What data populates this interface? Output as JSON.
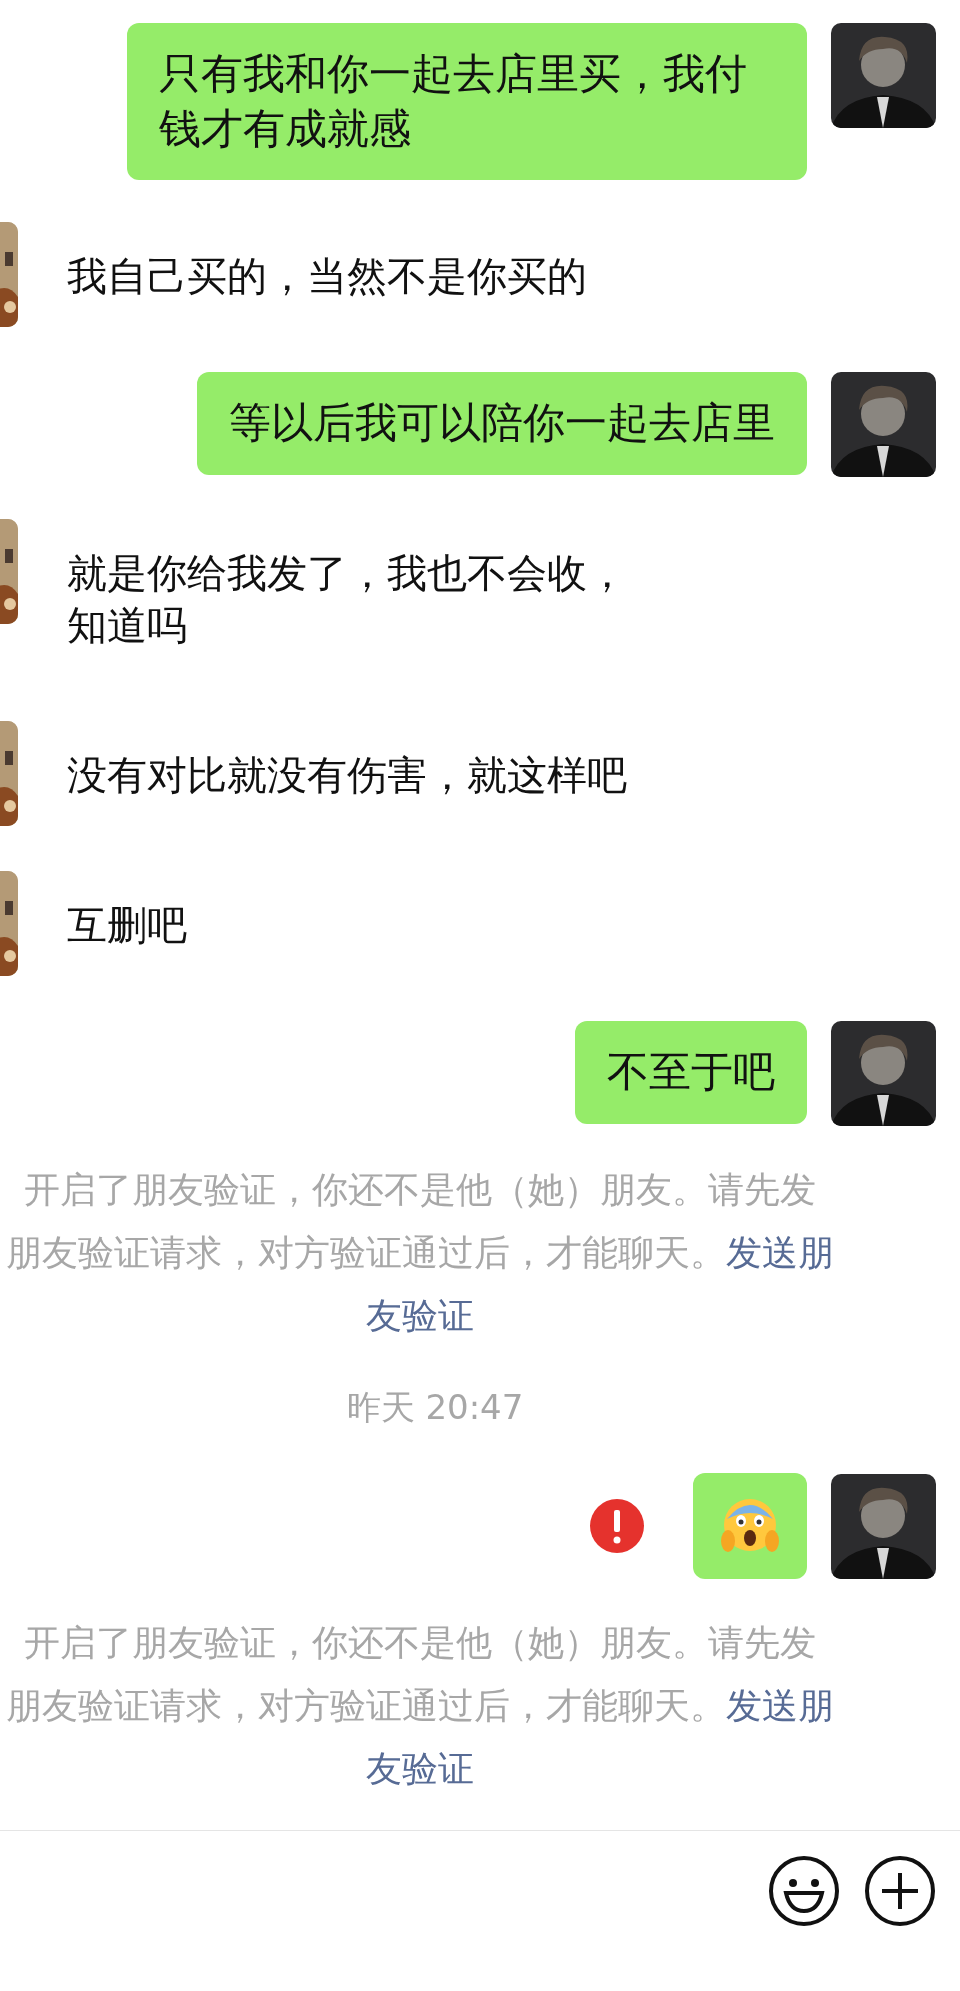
{
  "messages": [
    {
      "kind": "out",
      "text": "只有我和你一起去店里买，我付钱才有成就感",
      "failed": false
    },
    {
      "kind": "in",
      "text": "我自己买的，当然不是你买的"
    },
    {
      "kind": "out",
      "text": "等以后我可以陪你一起去店里",
      "failed": false
    },
    {
      "kind": "in",
      "lines": [
        "就是你给我发了，我也不会收，",
        "知道吗"
      ]
    },
    {
      "kind": "in",
      "text": "没有对比就没有伤害，就这样吧"
    },
    {
      "kind": "in",
      "text": "互删吧"
    },
    {
      "kind": "out",
      "text": "不至于吧",
      "failed": false
    },
    {
      "kind": "system",
      "lines": [
        "开启了朋友验证，你还不是他（她）朋友。请先发",
        "朋友验证请求，对方验证通过后，才能聊天。"
      ],
      "link_lines": [
        "发送朋",
        "友验证"
      ]
    },
    {
      "kind": "time",
      "text": "昨天 20:47"
    },
    {
      "kind": "sticker",
      "failed": true
    },
    {
      "kind": "system",
      "lines": [
        "开启了朋友验证，你还不是他（她）朋友。请先发",
        "朋友验证请求，对方验证通过后，才能聊天。"
      ],
      "link_lines": [
        "发送朋",
        "友验证"
      ]
    }
  ]
}
